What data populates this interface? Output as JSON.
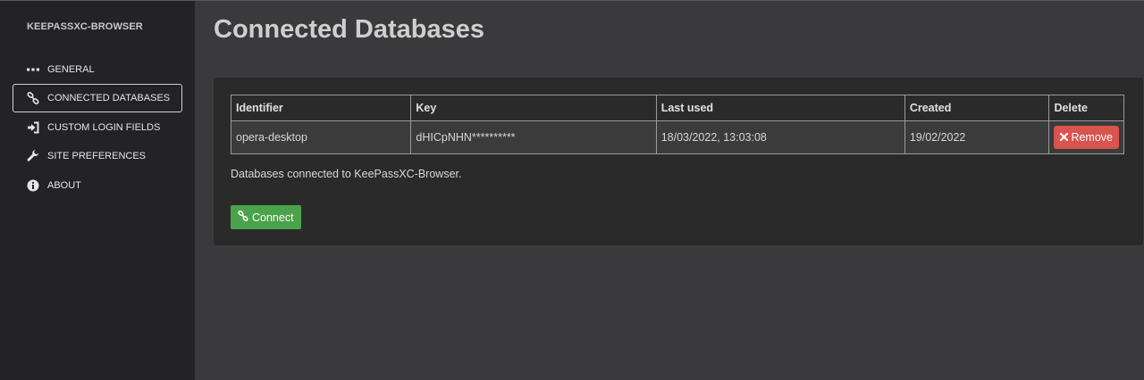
{
  "sidebar": {
    "brand": "KEEPASSXC-BROWSER",
    "items": [
      {
        "label": "GENERAL",
        "icon": "ellipsis-icon",
        "active": false
      },
      {
        "label": "CONNECTED DATABASES",
        "icon": "link-icon",
        "active": true
      },
      {
        "label": "CUSTOM LOGIN FIELDS",
        "icon": "sign-in-icon",
        "active": false
      },
      {
        "label": "SITE PREFERENCES",
        "icon": "wrench-icon",
        "active": false
      },
      {
        "label": "ABOUT",
        "icon": "info-icon",
        "active": false
      }
    ]
  },
  "main": {
    "title": "Connected Databases",
    "table": {
      "headers": [
        "Identifier",
        "Key",
        "Last used",
        "Created",
        "Delete"
      ],
      "rows": [
        {
          "identifier": "opera-desktop",
          "key": "dHICpNHN**********",
          "last_used": "18/03/2022, 13:03:08",
          "created": "19/02/2022",
          "remove_label": "Remove"
        }
      ]
    },
    "status_text": "Databases connected to KeePassXC-Browser.",
    "connect_label": "Connect"
  },
  "colors": {
    "sidebar_bg": "#232327",
    "main_bg": "#3a3a3c",
    "panel_bg": "#2b2a2a",
    "remove_button": "#d9534f",
    "connect_button": "#4aa24a"
  }
}
